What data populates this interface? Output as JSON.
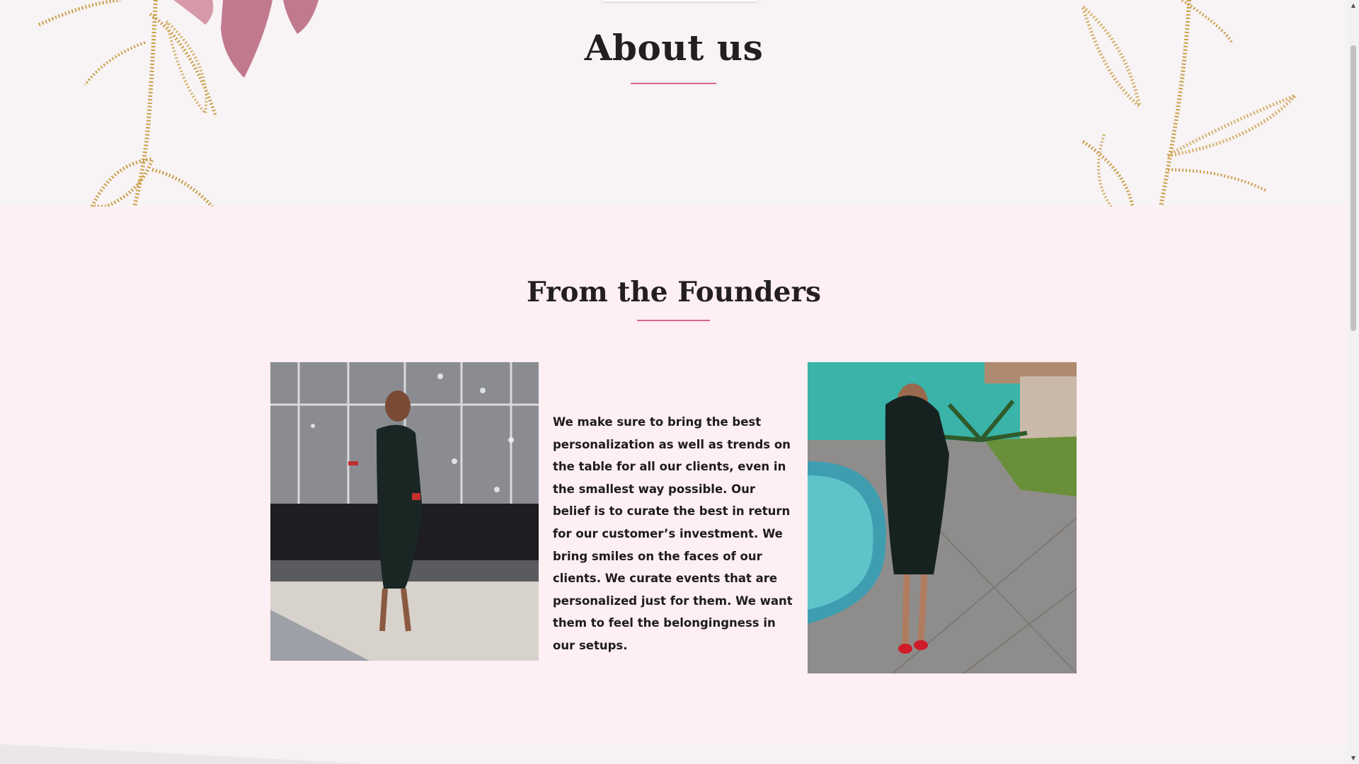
{
  "hero": {
    "title": "About us",
    "accent_color": "#d9648f"
  },
  "founders": {
    "heading": "From the Founders",
    "body": "We make sure to bring the best personalization as well as trends on the table for all our clients, even in the smallest way possible. Our belief is to curate the best in return for our customer’s investment. We bring smiles on the faces of our clients. We curate events that are personalized just for them. We want them to feel the belongingness in our setups.",
    "background_color": "#fdeff3"
  },
  "scrollbar": {
    "up_icon": "arrow-up-icon",
    "down_icon": "arrow-down-icon"
  }
}
